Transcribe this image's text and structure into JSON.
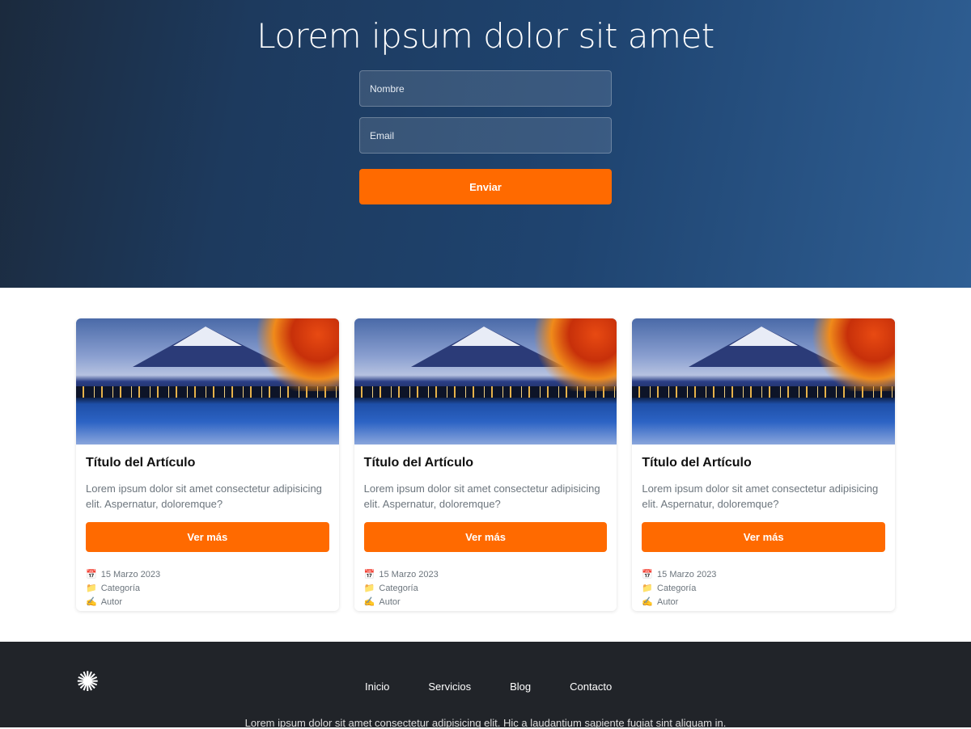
{
  "hero": {
    "title": "Lorem ipsum dolor sit amet",
    "name_placeholder": "Nombre",
    "email_placeholder": "Email",
    "submit_label": "Enviar"
  },
  "cards": [
    {
      "title": "Título del Artículo",
      "text": "Lorem ipsum dolor sit amet consectetur adipisicing elit. Aspernatur, doloremque?",
      "button": "Ver más",
      "date": "15 Marzo 2023",
      "category": "Categoría",
      "author": "Autor"
    },
    {
      "title": "Título del Artículo",
      "text": "Lorem ipsum dolor sit amet consectetur adipisicing elit. Aspernatur, doloremque?",
      "button": "Ver más",
      "date": "15 Marzo 2023",
      "category": "Categoría",
      "author": "Autor"
    },
    {
      "title": "Título del Artículo",
      "text": "Lorem ipsum dolor sit amet consectetur adipisicing elit. Aspernatur, doloremque?",
      "button": "Ver más",
      "date": "15 Marzo 2023",
      "category": "Categoría",
      "author": "Autor"
    }
  ],
  "icons": {
    "date": "calendar-icon",
    "category": "folder-icon",
    "author": "writing-hand-icon",
    "logo": "flower-icon"
  },
  "colors": {
    "accent": "#ff6a00",
    "footer_bg": "#212429"
  },
  "footer": {
    "nav": [
      "Inicio",
      "Servicios",
      "Blog",
      "Contacto"
    ],
    "text": "Lorem ipsum dolor sit amet consectetur adipisicing elit. Hic a laudantium sapiente fugiat sint aliquam in."
  }
}
